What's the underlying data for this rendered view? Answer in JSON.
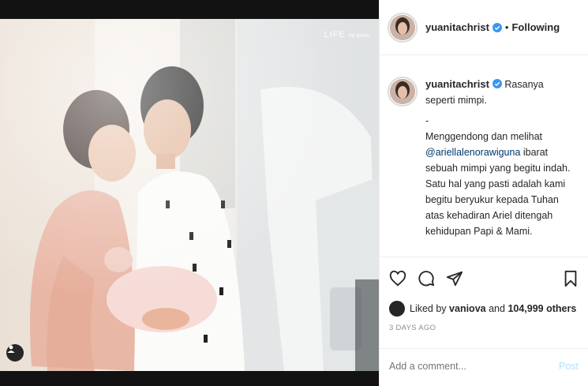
{
  "photo": {
    "watermark": "LIFE",
    "watermark_sub": "by axioo",
    "tag_icon": "user-tag-icon"
  },
  "header": {
    "username": "yuanitachrist",
    "verified_icon": "verified-badge-icon",
    "separator": "•",
    "follow_label": "Following"
  },
  "caption": {
    "username": "yuanitachrist",
    "first_line": "Rasanya seperti mimpi.",
    "divider": "-",
    "text_a": "Menggendong dan melihat ",
    "mention": "@ariellalenorawiguna",
    "text_b": " ibarat sebuah mimpi yang begitu indah.",
    "text_c": "Satu hal yang pasti adalah kami begitu beryukur kepada Tuhan atas kehadiran Ariel ditengah kehidupan Papi & Mami."
  },
  "actions": {
    "like_icon": "heart-icon",
    "comment_icon": "comment-icon",
    "share_icon": "share-icon",
    "save_icon": "bookmark-icon"
  },
  "likes": {
    "prefix": "Liked by",
    "user": "vaniova",
    "and": "and",
    "others": "104,999 others"
  },
  "timestamp": "3 DAYS AGO",
  "comment": {
    "placeholder": "Add a comment...",
    "post_label": "Post"
  },
  "colors": {
    "verified": "#3897f0",
    "link": "#00376b",
    "post_disabled": "#b2dffc",
    "muted": "#8e8e8e"
  }
}
